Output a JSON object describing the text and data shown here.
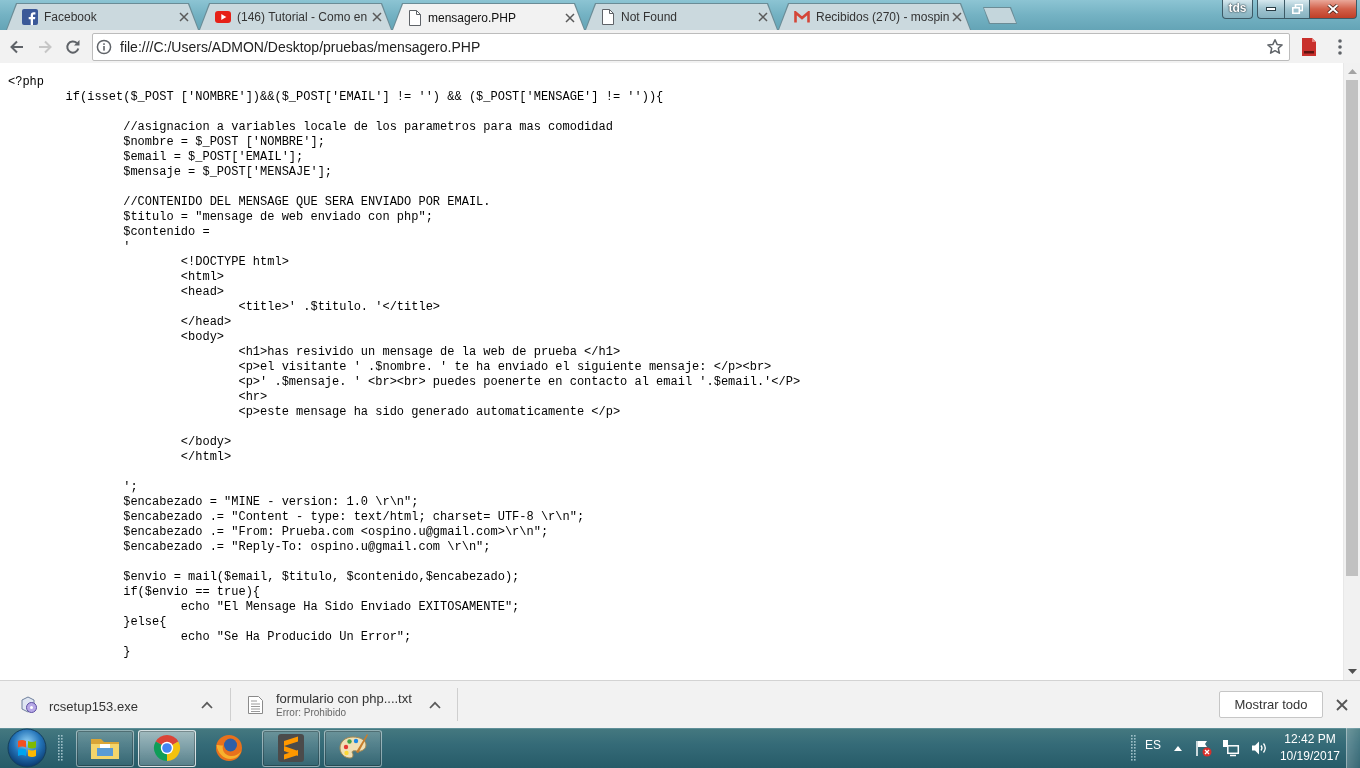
{
  "browser": {
    "tabs": [
      {
        "kind": "facebook",
        "title": "Facebook",
        "selected": false
      },
      {
        "kind": "youtube",
        "title": "(146) Tutorial - Como en",
        "selected": false
      },
      {
        "kind": "file",
        "title": "mensagero.PHP",
        "selected": true
      },
      {
        "kind": "file",
        "title": "Not Found",
        "selected": false
      },
      {
        "kind": "gmail",
        "title": "Recibidos (270) - mospin",
        "selected": false
      }
    ],
    "profile": "tds",
    "nav": [
      {
        "kind": "back",
        "disabled": false
      },
      {
        "kind": "forward",
        "disabled": true
      },
      {
        "kind": "reload",
        "disabled": false
      }
    ],
    "address": "file:///C:/Users/ADMON/Desktop/pruebas/mensagero.PHP"
  },
  "document": {
    "blocks": [
      [
        "<?php",
        "\tif(isset($_POST ['NOMBRE'])&&($_POST['EMAIL'] != '') && ($_POST['MENSAGE'] != '')){"
      ],
      [
        "\t\t//asignacion a variables locale de los parametros para mas comodidad",
        "\t\t$nombre = $_POST ['NOMBRE'];",
        "\t\t$email = $_POST['EMAIL'];",
        "\t\t$mensaje = $_POST['MENSAJE'];"
      ],
      [
        "\t\t//CONTENIDO DEL MENSAGE QUE SERA ENVIADO POR EMAIL.",
        "\t\t$titulo = \"mensage de web enviado con php\";",
        "\t\t$contenido =",
        "\t\t'",
        "\t\t\t<!DOCTYPE html>",
        "\t\t\t<html>",
        "\t\t\t<head>",
        "\t\t\t\t<title>' .$titulo. '</title>",
        "\t\t\t</head>",
        "\t\t\t<body>",
        "\t\t\t\t<h1>has resivido un mensage de la web de prueba </h1>",
        "\t\t\t\t<p>el visitante ' .$nombre. ' te ha enviado el siguiente mensaje: </p><br>",
        "\t\t\t\t<p>' .$mensaje. ' <br><br> puedes poenerte en contacto al email '.$email.'</P>",
        "\t\t\t\t<hr>",
        "\t\t\t\t<p>este mensage ha sido generado automaticamente </p>"
      ],
      [
        "\t\t\t</body>",
        "\t\t\t</html>"
      ],
      [
        "\t\t';",
        "\t\t$encabezado = \"MINE - version: 1.0 \\r\\n\";",
        "\t\t$encabezado .= \"Content - type: text/html; charset= UTF-8 \\r\\n\";",
        "\t\t$encabezado .= \"From: Prueba.com <ospino.u@gmail.com>\\r\\n\";",
        "\t\t$encabezado .= \"Reply-To: ospino.u@gmail.com \\r\\n\";"
      ],
      [
        "\t\t$envio = mail($email, $titulo, $contenido,$encabezado);",
        "\t\tif($envio == true){",
        "\t\t\techo \"El Mensage Ha Sido Enviado EXITOSAMENTE\";",
        "\t\t}else{",
        "\t\t\techo \"Se Ha Producido Un Error\";",
        "\t\t}"
      ]
    ]
  },
  "downloads": {
    "items": [
      {
        "kind": "installer",
        "name": "rcsetup153.exe"
      },
      {
        "kind": "text",
        "name": "formulario con php....txt",
        "status": "Error: Prohibido"
      }
    ],
    "show_all": "Mostrar todo"
  },
  "taskbar": {
    "apps": [
      {
        "kind": "explorer",
        "running": true,
        "selected": false
      },
      {
        "kind": "chrome",
        "running": true,
        "selected": true
      },
      {
        "kind": "firefox",
        "running": false,
        "selected": false
      },
      {
        "kind": "sublime",
        "running": true,
        "selected": false
      },
      {
        "kind": "paint",
        "running": true,
        "selected": false
      }
    ],
    "language": "ES",
    "time": "12:42 PM",
    "date": "10/19/2017"
  }
}
